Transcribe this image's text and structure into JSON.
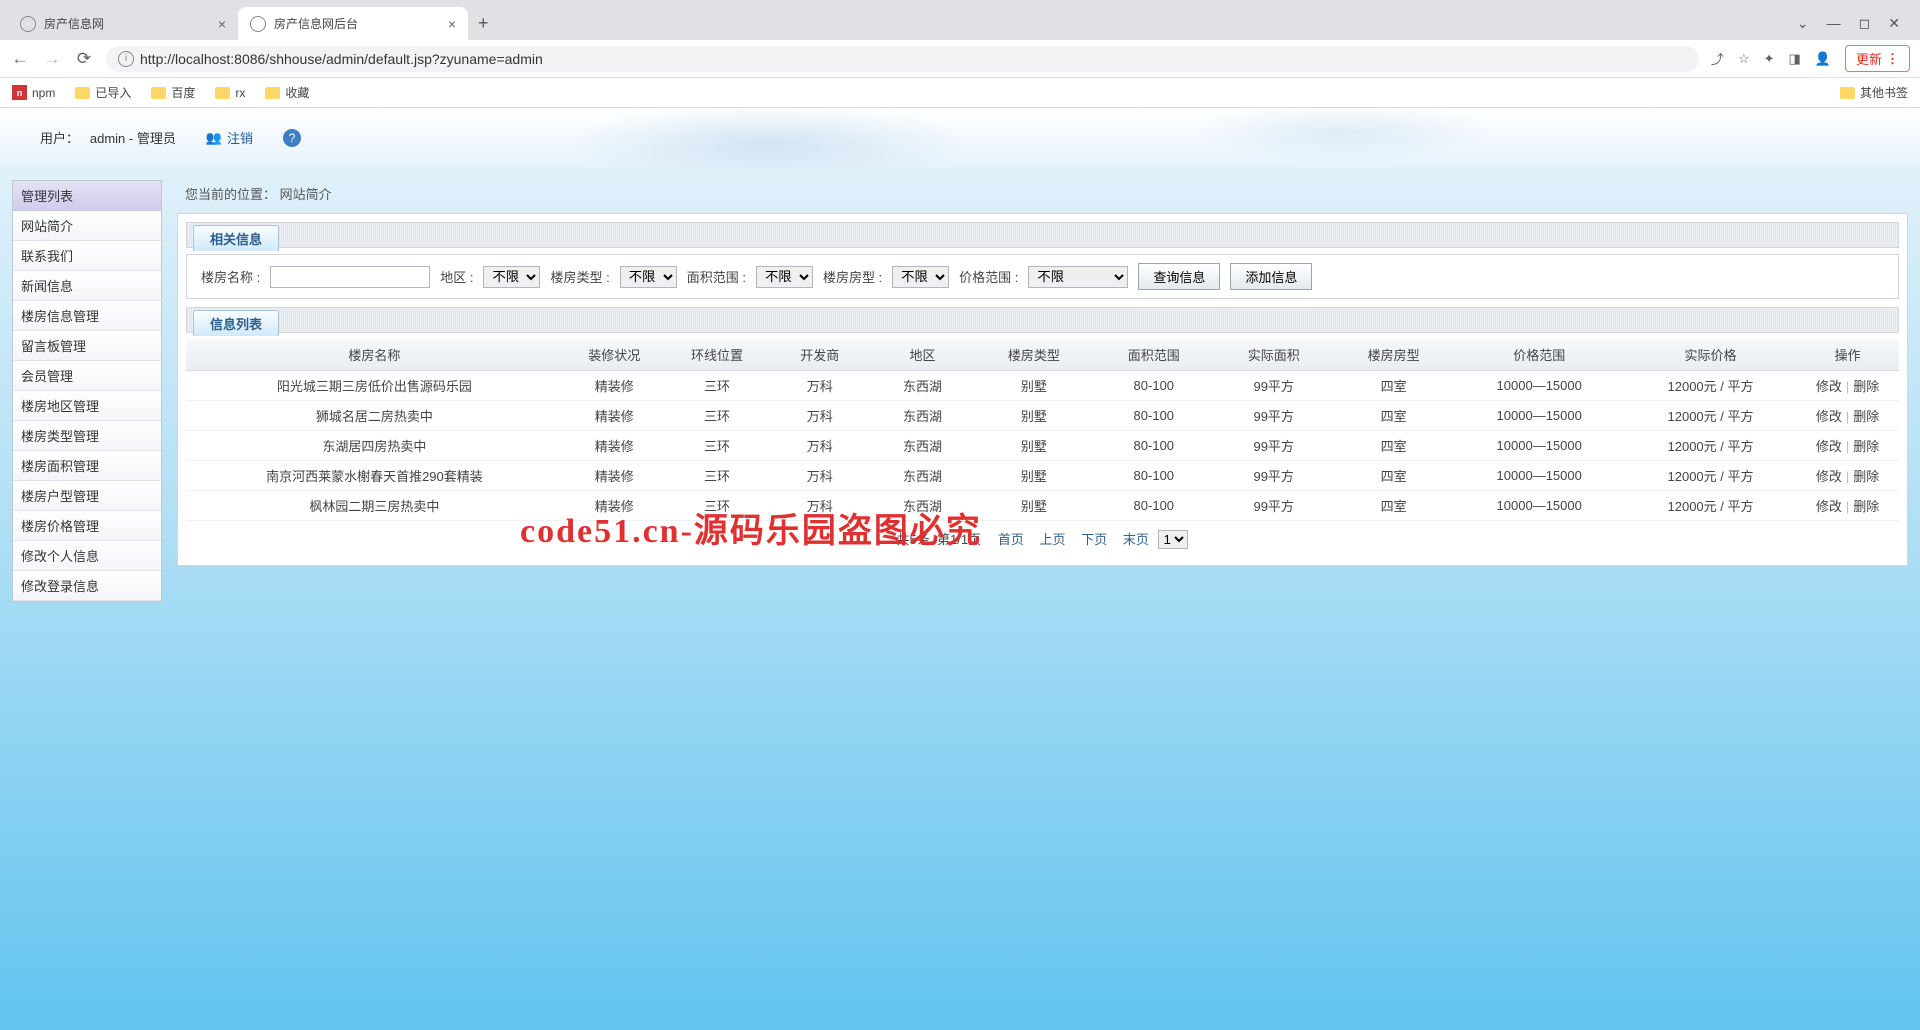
{
  "browser": {
    "tabs": [
      {
        "title": "房产信息网",
        "active": false
      },
      {
        "title": "房产信息网后台",
        "active": true
      }
    ],
    "url_display": "http://localhost:8086/shhouse/admin/default.jsp?zyuname=admin",
    "update_label": "更新",
    "bookmarks": [
      "npm",
      "已导入",
      "百度",
      "rx",
      "收藏"
    ],
    "other_bookmarks": "其他书签"
  },
  "header": {
    "user_label": "用户：",
    "user_value": "admin - 管理员",
    "logout": "注销"
  },
  "sidebar": {
    "header": "管理列表",
    "items": [
      "网站简介",
      "联系我们",
      "新闻信息",
      "楼房信息管理",
      "留言板管理",
      "会员管理",
      "楼房地区管理",
      "楼房类型管理",
      "楼房面积管理",
      "楼房户型管理",
      "楼房价格管理",
      "修改个人信息",
      "修改登录信息"
    ]
  },
  "breadcrumb": {
    "label": "您当前的位置：",
    "value": "网站简介"
  },
  "filter": {
    "section_title": "相关信息",
    "name_label": "楼房名称 :",
    "region_label": "地区 :",
    "type_label": "楼房类型 :",
    "area_label": "面积范围 :",
    "house_type_label": "楼房房型 :",
    "price_label": "价格范围 :",
    "unlimited": "不限",
    "query_btn": "查询信息",
    "add_btn": "添加信息"
  },
  "list": {
    "section_title": "信息列表",
    "columns": [
      "楼房名称",
      "装修状况",
      "环线位置",
      "开发商",
      "地区",
      "楼房类型",
      "面积范围",
      "实际面积",
      "楼房房型",
      "价格范围",
      "实际价格",
      "操作"
    ],
    "edit": "修改",
    "delete": "删除",
    "rows": [
      {
        "name": "阳光城三期三房低价出售源码乐园",
        "finish": "精装修",
        "ring": "三环",
        "dev": "万科",
        "region": "东西湖",
        "type": "别墅",
        "area": "80-100",
        "real_area": "99平方",
        "house": "四室",
        "price": "10000—15000",
        "real_price": "12000元 / 平方"
      },
      {
        "name": "狮城名居二房热卖中",
        "finish": "精装修",
        "ring": "三环",
        "dev": "万科",
        "region": "东西湖",
        "type": "别墅",
        "area": "80-100",
        "real_area": "99平方",
        "house": "四室",
        "price": "10000—15000",
        "real_price": "12000元 / 平方"
      },
      {
        "name": "东湖居四房热卖中",
        "finish": "精装修",
        "ring": "三环",
        "dev": "万科",
        "region": "东西湖",
        "type": "别墅",
        "area": "80-100",
        "real_area": "99平方",
        "house": "四室",
        "price": "10000—15000",
        "real_price": "12000元 / 平方"
      },
      {
        "name": "南京河西莱蒙水榭春天首推290套精装",
        "finish": "精装修",
        "ring": "三环",
        "dev": "万科",
        "region": "东西湖",
        "type": "别墅",
        "area": "80-100",
        "real_area": "99平方",
        "house": "四室",
        "price": "10000—15000",
        "real_price": "12000元 / 平方"
      },
      {
        "name": "枫林园二期三房热卖中",
        "finish": "精装修",
        "ring": "三环",
        "dev": "万科",
        "region": "东西湖",
        "type": "别墅",
        "area": "80-100",
        "real_area": "99平方",
        "house": "四室",
        "price": "10000—15000",
        "real_price": "12000元 / 平方"
      }
    ]
  },
  "pagination": {
    "total": "共5条",
    "page": "第1/1页",
    "first": "首页",
    "prev": "上页",
    "next": "下页",
    "last": "末页",
    "select_value": "1"
  },
  "watermark": "code51.cn-源码乐园盗图必究"
}
